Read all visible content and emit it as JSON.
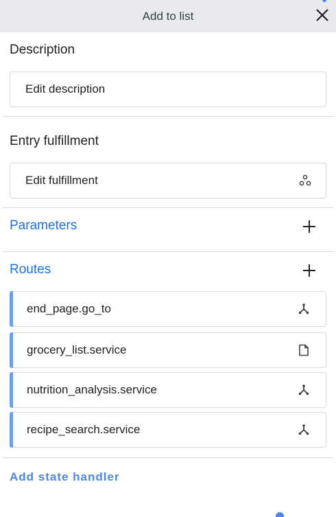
{
  "header": {
    "title": "Add to list"
  },
  "description": {
    "label": "Description",
    "field_text": "Edit description"
  },
  "entry_fulfillment": {
    "label": "Entry fulfillment",
    "field_text": "Edit fulfillment"
  },
  "parameters": {
    "label": "Parameters"
  },
  "routes": {
    "label": "Routes",
    "items": [
      {
        "label": "end_page.go_to",
        "icon": "fork-icon"
      },
      {
        "label": "grocery_list.service",
        "icon": "document-icon"
      },
      {
        "label": "nutrition_analysis.service",
        "icon": "fork-icon"
      },
      {
        "label": "recipe_search.service",
        "icon": "fork-icon"
      }
    ]
  },
  "footer": {
    "add_state_handler": "Add state handler"
  },
  "colors": {
    "accent": "#1a73e8",
    "route_bar": "#6f9cf4",
    "header_bg": "#e8eaed"
  }
}
